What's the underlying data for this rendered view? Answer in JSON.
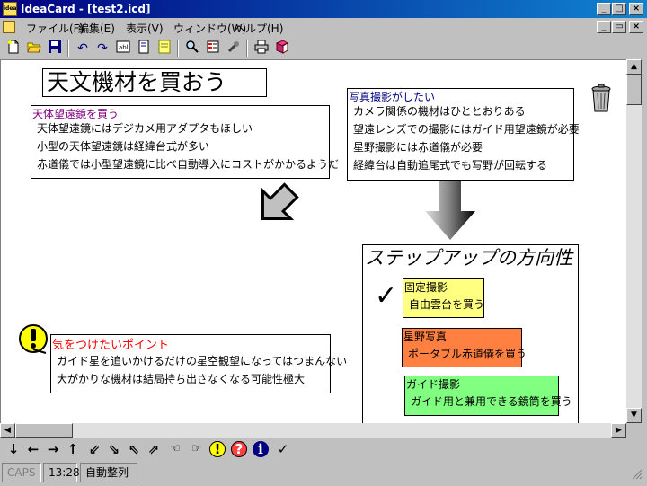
{
  "window": {
    "title": "IdeaCard - [test2.icd]",
    "app_icon_text": "idea",
    "minimize": "_",
    "maximize": "□",
    "close": "×"
  },
  "menu": {
    "items": [
      "ファイル(F)",
      "編集(E)",
      "表示(V)",
      "ウィンドウ(W)",
      "ヘルプ(H)"
    ],
    "mdi_min": "_",
    "mdi_restore": "▭",
    "mdi_close": "×"
  },
  "toolbar": {
    "icons": [
      "new-icon",
      "open-icon",
      "save-icon",
      "undo-icon",
      "redo-icon",
      "text-card-icon",
      "card-icon",
      "note-icon",
      "search-icon",
      "list-icon",
      "wrench-icon",
      "print-icon",
      "book-icon"
    ]
  },
  "canvas": {
    "title_card": {
      "text": "天文機材を買おう"
    },
    "card_telescope": {
      "title": "天体望遠鏡を買う",
      "rows": [
        "天体望遠鏡にはデジカメ用アダプタもほしい",
        "小型の天体望遠鏡は経緯台式が多い",
        "赤道儀では小型望遠鏡に比べ自動導入にコストがかかるようだ"
      ]
    },
    "card_photo": {
      "title": "写真撮影がしたい",
      "rows": [
        "カメラ関係の機材はひととおりある",
        "望遠レンズでの撮影にはガイド用望遠鏡が必要",
        "星野撮影には赤道儀が必要",
        "経緯台は自動追尾式でも写野が回転する"
      ]
    },
    "card_caution": {
      "title": "気をつけたいポイント",
      "rows": [
        "ガイド星を追いかけるだけの星空観望になってはつまんない",
        "大がかりな機材は結局持ち出さなくなる可能性極大"
      ]
    },
    "card_step": {
      "title": "ステップアップの方向性"
    },
    "sub_fixed": {
      "title": "固定撮影",
      "body": "自由雲台を買う",
      "color": "#ffff80"
    },
    "sub_star": {
      "title": "星野写真",
      "body": "ポータブル赤道儀を買う",
      "color": "#ff8040"
    },
    "sub_guide": {
      "title": "ガイド撮影",
      "body": "ガイド用と兼用できる鏡筒を買う",
      "color": "#80ff80"
    },
    "checkmark": "✓",
    "caution_mark": "!",
    "colors": {
      "telescope_title": "#800080",
      "photo_title": "#000080",
      "caution_title": "#ff0000"
    }
  },
  "bottom_toolbar": {
    "icons": [
      {
        "name": "arrow-down-icon",
        "glyph": "↓"
      },
      {
        "name": "arrow-left-icon",
        "glyph": "←"
      },
      {
        "name": "arrow-right-icon",
        "glyph": "→"
      },
      {
        "name": "arrow-up-icon",
        "glyph": "↑"
      },
      {
        "name": "arrow-down-left-icon",
        "glyph": "⇙"
      },
      {
        "name": "arrow-down-right-icon",
        "glyph": "⇘"
      },
      {
        "name": "arrow-up-left-icon",
        "glyph": "⇖"
      },
      {
        "name": "arrow-up-right-icon",
        "glyph": "⇗"
      },
      {
        "name": "hand-left-icon",
        "glyph": "☜"
      },
      {
        "name": "hand-right-icon",
        "glyph": "☞"
      },
      {
        "name": "exclamation-icon",
        "glyph": "!"
      },
      {
        "name": "question-icon",
        "glyph": "?"
      },
      {
        "name": "info-icon",
        "glyph": "i"
      },
      {
        "name": "check-icon",
        "glyph": "✓"
      }
    ]
  },
  "status": {
    "caps": "CAPS",
    "time": "13:28",
    "mode": "自動整列"
  }
}
